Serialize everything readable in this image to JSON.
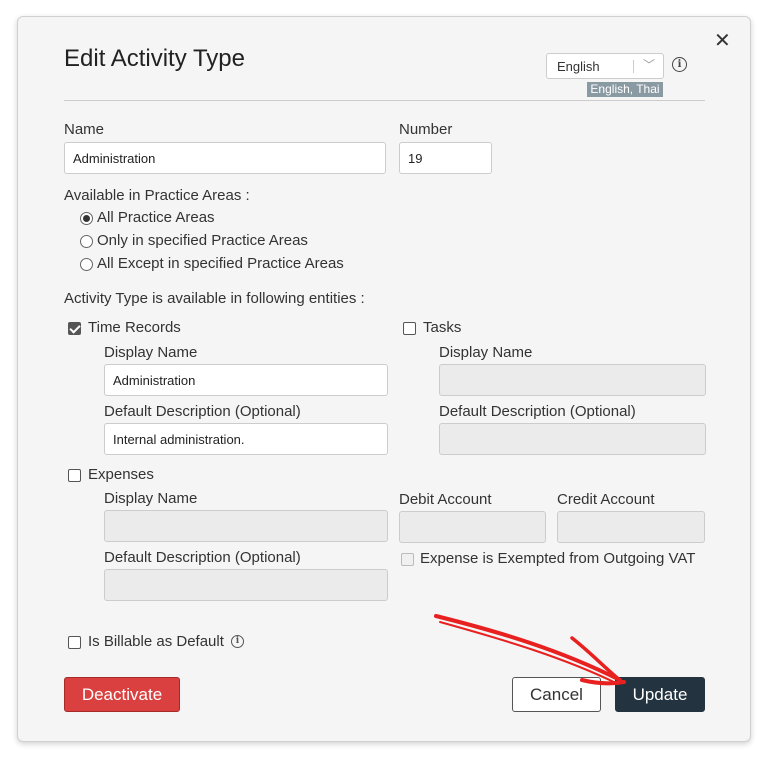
{
  "dialog": {
    "title": "Edit Activity Type",
    "language": {
      "selected": "English",
      "badge": "English, Thai"
    }
  },
  "fields": {
    "name_label": "Name",
    "name_value": "Administration",
    "number_label": "Number",
    "number_value": "19"
  },
  "practice_areas": {
    "label": "Available in Practice Areas :",
    "options": [
      {
        "label": "All Practice Areas",
        "selected": true
      },
      {
        "label": "Only in specified Practice Areas",
        "selected": false
      },
      {
        "label": "All Except in specified Practice Areas",
        "selected": false
      }
    ]
  },
  "entities": {
    "label": "Activity Type is available in following entities :",
    "time_records": {
      "label": "Time Records",
      "checked": true,
      "display_name_label": "Display Name",
      "display_name_value": "Administration",
      "default_description_label": "Default Description (Optional)",
      "default_description_value": "Internal administration."
    },
    "tasks": {
      "label": "Tasks",
      "checked": false,
      "display_name_label": "Display Name",
      "default_description_label": "Default Description (Optional)"
    },
    "expenses": {
      "label": "Expenses",
      "checked": false,
      "display_name_label": "Display Name",
      "default_description_label": "Default Description (Optional)",
      "debit_account_label": "Debit Account",
      "credit_account_label": "Credit Account",
      "vat_exempt_label": "Expense is Exempted from Outgoing VAT"
    }
  },
  "billable": {
    "label": "Is Billable as Default",
    "checked": false
  },
  "buttons": {
    "deactivate": "Deactivate",
    "cancel": "Cancel",
    "update": "Update"
  },
  "colors": {
    "danger": "#d9403f",
    "primary": "#233440",
    "annotation_arrow": "#e8201f"
  }
}
